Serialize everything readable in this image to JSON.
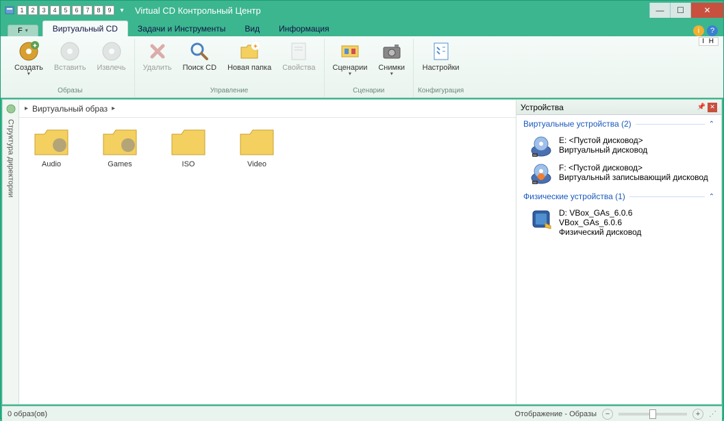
{
  "window": {
    "title": "Virtual CD Контрольный Центр"
  },
  "qat_numbers": [
    "1",
    "2",
    "3",
    "4",
    "5",
    "6",
    "7",
    "8",
    "9"
  ],
  "ribbon": {
    "file_label": "F",
    "tabs": [
      {
        "label": "Виртуальный CD",
        "active": true
      },
      {
        "label": "Задачи и Инструменты",
        "active": false
      },
      {
        "label": "Вид",
        "active": false
      },
      {
        "label": "Информация",
        "active": false
      }
    ],
    "ih_badge": "I H",
    "groups": {
      "images": {
        "label": "Образы",
        "create": "Создать",
        "insert": "Вставить",
        "eject": "Извлечь"
      },
      "manage": {
        "label": "Управление",
        "delete": "Удалить",
        "search": "Поиск CD",
        "newfolder": "Новая папка",
        "properties": "Свойства"
      },
      "scenarios": {
        "label": "Сценарии",
        "scenarios": "Сценарии",
        "snapshots": "Снимки"
      },
      "config": {
        "label": "Конфигурация",
        "settings": "Настройки"
      }
    }
  },
  "sidebar": {
    "label": "Структура директории"
  },
  "breadcrumb": {
    "root": "Виртуальный образ"
  },
  "folders": [
    {
      "name": "Audio"
    },
    {
      "name": "Games"
    },
    {
      "name": "ISO"
    },
    {
      "name": "Video"
    }
  ],
  "devices": {
    "panel_title": "Устройства",
    "virtual_header": "Виртуальные устройства (2)",
    "virtual": [
      {
        "title": "E: <Пустой дисковод>",
        "sub": "Виртуальный дисковод"
      },
      {
        "title": "F: <Пустой дисковод>",
        "sub": "Виртуальный записывающий дисковод"
      }
    ],
    "physical_header": "Физические устройства (1)",
    "physical": [
      {
        "title": "D: VBox_GAs_6.0.6",
        "sub1": "VBox_GAs_6.0.6",
        "sub2": "Физический дисковод"
      }
    ]
  },
  "status": {
    "left": "0 образ(ов)",
    "right": "Отображение - Образы"
  }
}
